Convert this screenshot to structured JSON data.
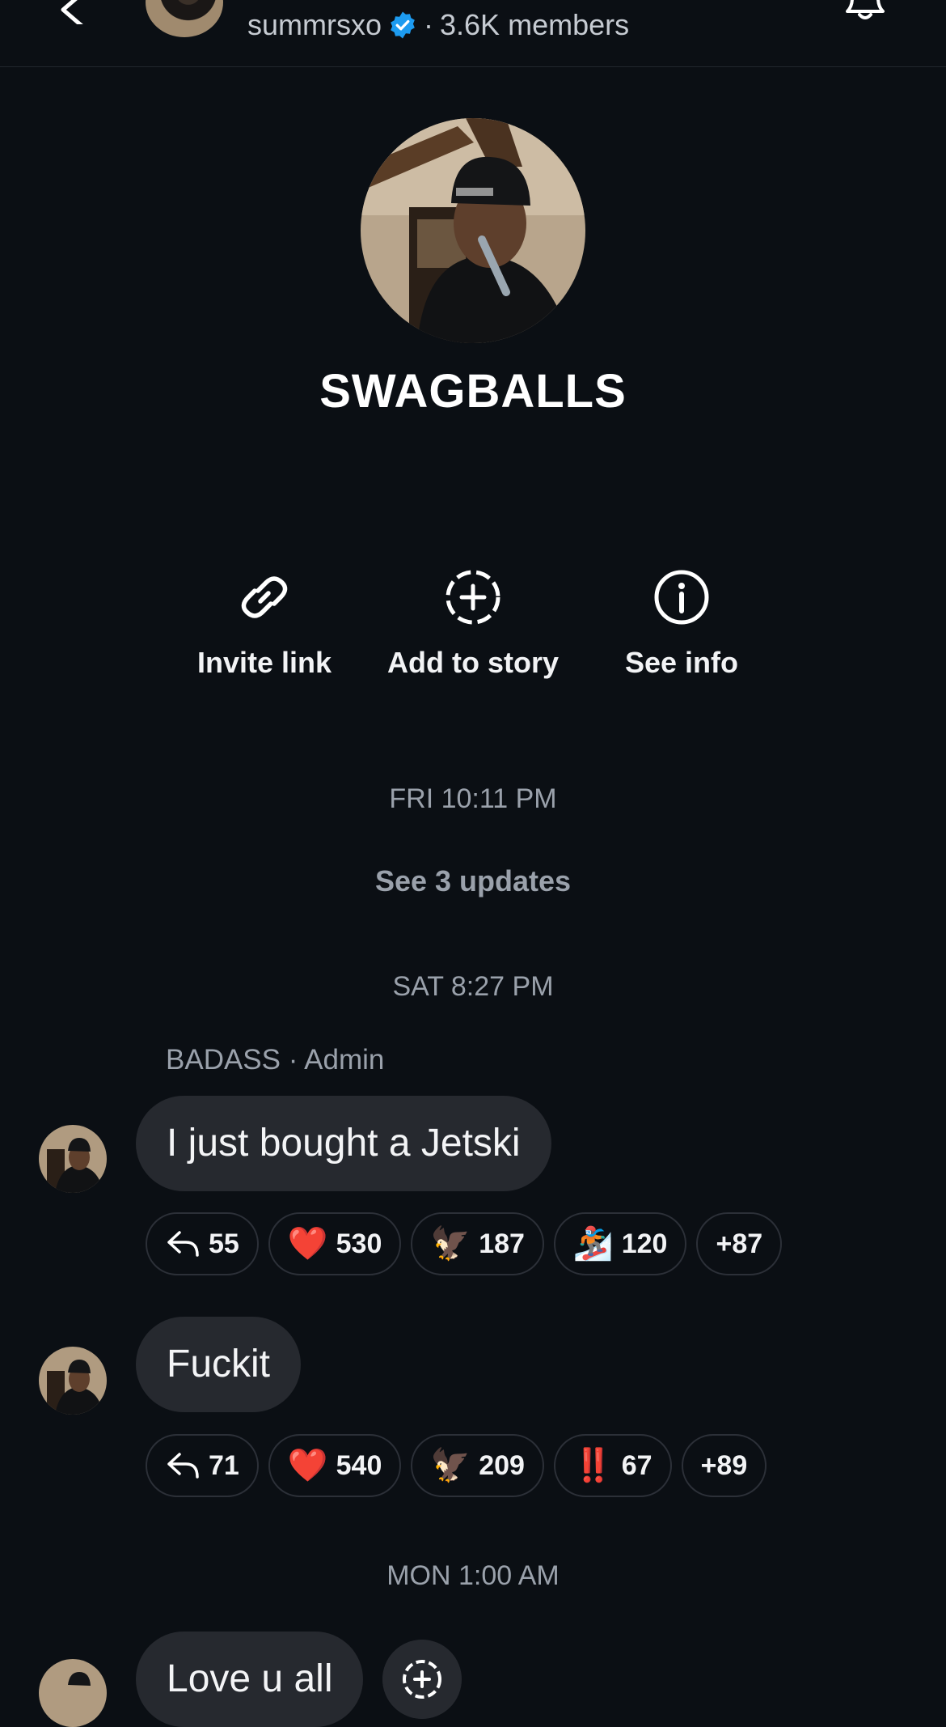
{
  "header": {
    "channel_name": "summrsxo",
    "separator": "·",
    "members": "3.6K members"
  },
  "group": {
    "title": "SWAGBALLS"
  },
  "actions": [
    {
      "label": "Invite link",
      "icon": "link-icon"
    },
    {
      "label": "Add to story",
      "icon": "add-story-icon"
    },
    {
      "label": "See info",
      "icon": "info-icon"
    }
  ],
  "timeline": {
    "ts1": "FRI 10:11 PM",
    "updates": "See 3 updates",
    "ts2": "SAT 8:27 PM",
    "ts3": "MON 1:00 AM"
  },
  "sender": "BADASS · Admin",
  "messages": [
    {
      "text": "I just bought a Jetski",
      "reactions": [
        {
          "icon": "reply-icon",
          "count": "55"
        },
        {
          "emoji": "❤️",
          "count": "530"
        },
        {
          "emoji": "🦅",
          "count": "187"
        },
        {
          "emoji": "🏂",
          "count": "120"
        },
        {
          "count": "+87"
        }
      ]
    },
    {
      "text": "Fuckit",
      "reactions": [
        {
          "icon": "reply-icon",
          "count": "71"
        },
        {
          "emoji": "❤️",
          "count": "540"
        },
        {
          "emoji": "🦅",
          "count": "209"
        },
        {
          "emoji": "‼️",
          "count": "67"
        },
        {
          "count": "+89"
        }
      ]
    },
    {
      "text": "Love u all"
    }
  ],
  "colors": {
    "background": "#0b0f14",
    "bubble": "#26292f",
    "muted_text": "#9aa1ab",
    "verified": "#1d9bf0",
    "heart": "#e0245e"
  }
}
